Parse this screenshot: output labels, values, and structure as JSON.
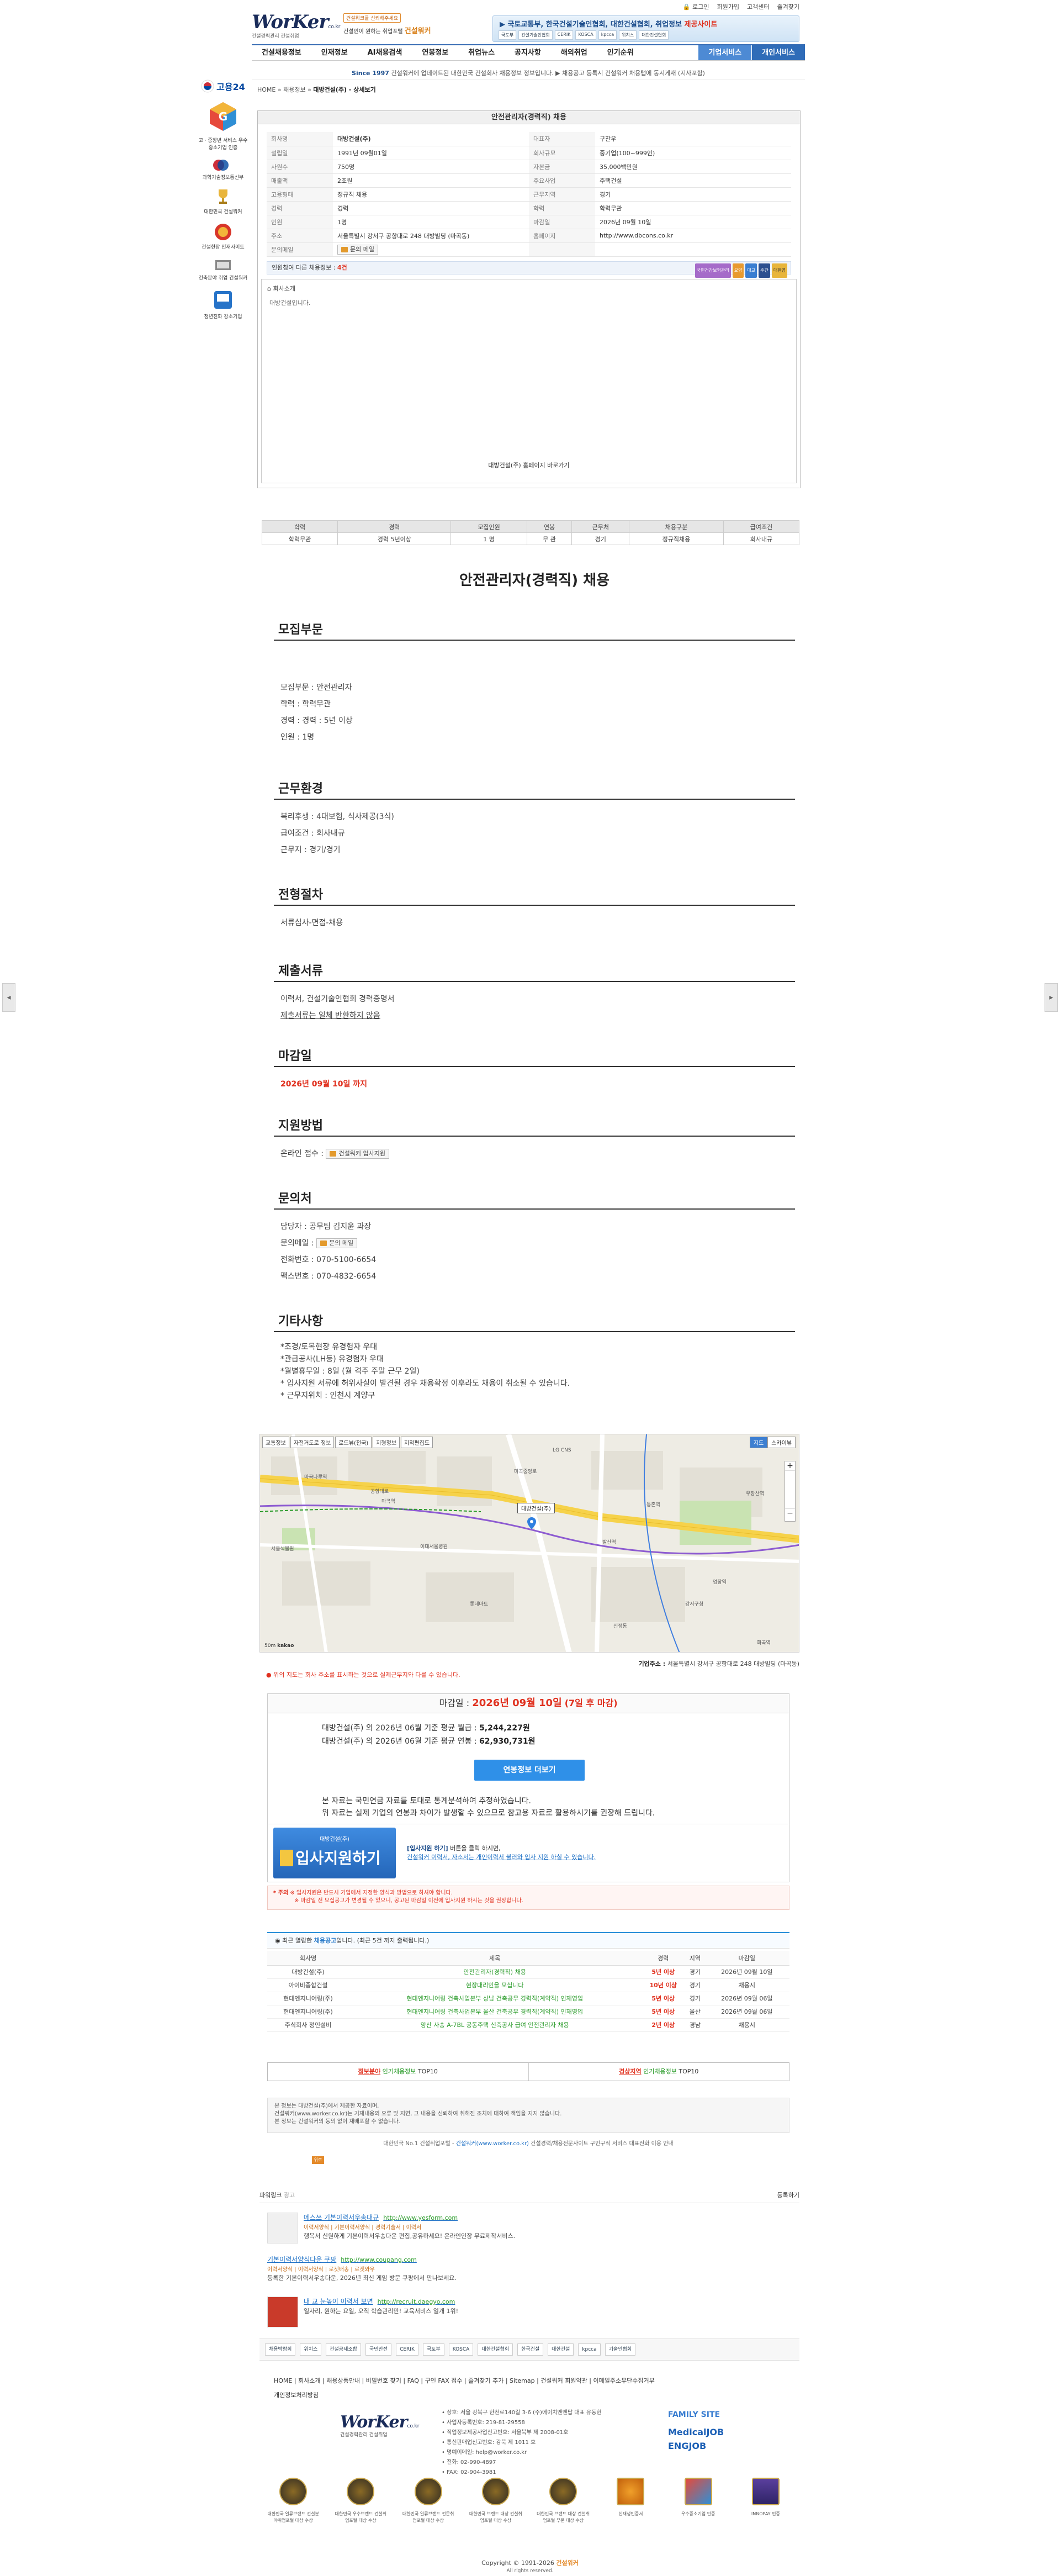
{
  "header": {
    "logo_text": "WorKer",
    "logo_domain": "co.kr",
    "logo_sub": "건설경력관리 건설취업",
    "tagline_badge": "건설워크를 신뢰해주세요",
    "tagline_text": "건설인이 원하는 취업포털",
    "tagline_brand": "건설워커",
    "util": [
      "로그인",
      "회원가입",
      "고객센터",
      "즐겨찾기"
    ],
    "banner_title": "국토교통부, 한국건설기술인협회, 대한건설협회, 취업정보",
    "banner_highlight": "제공사이트",
    "banner_logos": [
      "국토부",
      "건설기술인협회",
      "CERIK",
      "KOSCA",
      "kpcca",
      "위치스",
      "대한건설협회"
    ]
  },
  "nav": {
    "items": [
      "건설채용정보",
      "인재정보",
      "AI채용검색",
      "연봉정보",
      "취업뉴스",
      "공지사항",
      "해외취업",
      "인기순위"
    ],
    "right": [
      "기업서비스",
      "개인서비스"
    ]
  },
  "notice": {
    "since": "Since 1997",
    "text": "건설워커에 업데이트된 대한민국 건설회사 채용정보 정보입니다. ▶ 채용공고 등록시 건설워커 채용탭에 동시게재 (지사포함)"
  },
  "breadcrumb": {
    "home": "HOME",
    "sep1": "»",
    "l1": "채용정보",
    "sep2": "»",
    "l2": "대방건설(주) - 상세보기"
  },
  "sidebar": {
    "items": [
      {
        "label": "고용24",
        "icon": "korea-flag-icon"
      },
      {
        "label": "고 · 중장년 서비스 우수중소기업 인증",
        "icon": "g-cube-icon"
      },
      {
        "label": "과학기술정보통신부",
        "icon": "ministry-icon"
      },
      {
        "label": "대한민국 건설워커",
        "icon": "trophy-icon"
      },
      {
        "label": "건설현장 인재사이트",
        "icon": "red-medal-icon"
      },
      {
        "label": "건축분야 취업 건설워커",
        "icon": "book-icon"
      },
      {
        "label": "청년친화 강소기업",
        "icon": "blue-badge-icon"
      }
    ]
  },
  "job": {
    "box_title": "안전관리자(경력직) 채용",
    "info": [
      [
        "회사명",
        "대방건설(주)",
        "대표자",
        "구찬우"
      ],
      [
        "설립일",
        "1991년 09월01일",
        "회사규모",
        "중기업(100~999인)"
      ],
      [
        "사원수",
        "750명",
        "자본금",
        "35,000백만원"
      ],
      [
        "매출액",
        "2조원",
        "주요사업",
        "주택건설"
      ],
      [
        "고용형태",
        "정규직 채용",
        "근무지역",
        "경기"
      ],
      [
        "경력",
        "경력",
        "학력",
        "학력무관"
      ],
      [
        "인원",
        "1명",
        "마감일",
        "2026년 09월 10일"
      ],
      [
        "주소",
        "서울특별시 강서구 공항대로 248 대방빌딩 (마곡동)",
        "홈페이지",
        "http://www.dbcons.co.kr"
      ],
      [
        "문의메일",
        "문의 메일",
        "",
        ""
      ]
    ],
    "summary_prefix": "인원참여 다른 채용정보 :",
    "summary_count": "4건",
    "summary_tags": [
      "국민건강보험관리",
      "요양",
      "대교",
      "주간",
      "대환영"
    ],
    "intro_header": "회사소개",
    "intro_body": "대방건설입니다.",
    "homepage_link": "대방건설(주) 홈페이지 바로가기"
  },
  "conditions": {
    "headers": [
      "학력",
      "경력",
      "모집인원",
      "연봉",
      "근무처",
      "채용구분",
      "급여조건"
    ],
    "values": [
      "학력무관",
      "경력 5년이상",
      "1 명",
      "무 관",
      "경기",
      "정규직채용",
      "회사내규"
    ]
  },
  "detail": {
    "title": "안전관리자(경력직) 채용",
    "recruit": {
      "heading": "모집부문",
      "lines": [
        "모집부문 : 안전관리자",
        "학력 : 학력무관",
        "경력 : 경력 : 5년 이상",
        "인원 : 1명"
      ]
    },
    "work": {
      "heading": "근무환경",
      "lines": [
        "복리후생 : 4대보험, 식사제공(3식)",
        "급여조건 : 회사내규",
        "근무지 : 경기/경기"
      ]
    },
    "process": {
      "heading": "전형절차",
      "lines": [
        "서류심사-면접-채용"
      ]
    },
    "docs": {
      "heading": "제출서류",
      "lines": [
        "이력서, 건설기술인협회 경력증명서",
        "제출서류는 일체 반환하지 않음"
      ]
    },
    "deadline": {
      "heading": "마감일",
      "value": "2026년 09월 10일 까지"
    },
    "apply": {
      "heading": "지원방법",
      "label": "온라인 접수 :",
      "btn": "건설워커 입사지원"
    },
    "contact": {
      "heading": "문의처",
      "person": "담당자 : 공무팀 김지윤 과장",
      "mail_label": "문의메일 :",
      "mail_btn": "문의 메일",
      "phone": "전화번호 : 070-5100-6654",
      "fax": "팩스번호 : 070-4832-6654"
    },
    "etc": {
      "heading": "기타사항",
      "lines": [
        "*조경/토목현장 유경험자 우대",
        "*관급공사(LH등) 유경험자 우대",
        "*월별휴무일 : 8일 (월 격주 주말 근무 2일)",
        "* 입사지원 서류에 허위사실이 발견될 경우 채용확정 이후라도 채용이 취소될 수 있습니다.",
        "* 근무지위치 : 인천시 계양구"
      ]
    }
  },
  "map": {
    "tabs": [
      "교통정보",
      "자전거도로 정보",
      "로드뷰(전국)",
      "지형정보",
      "지적편집도"
    ],
    "types": [
      "지도",
      "스카이뷰"
    ],
    "pin_label": "대방건설(주)",
    "labels": [
      "마곡나루역",
      "LG CNS",
      "발산역",
      "우장산역",
      "마곡역",
      "서울식물원",
      "이대서울병원",
      "롯데마트",
      "강서구청",
      "신정동",
      "화곡역",
      "공항대로",
      "마곡중앙로",
      "등촌역",
      "염창역"
    ],
    "scale": "50m",
    "copyright": "kakao",
    "address_label": "기업주소 :",
    "address": "서울특별시 강서구 공항대로 248 대방빌딩 (마곡동)",
    "note": "위의 지도는 회사 주소를 표시하는 것으로 실제근무지와 다를 수 있습니다."
  },
  "stats": {
    "deadline_prefix": "마감일 :",
    "deadline_date": "2026년 09월 10일",
    "deadline_suffix": "(7일 후 마감)",
    "line1_pre": "대방건설(주) 의 2026년 06월 기준 평균 월급 :",
    "line1_val": "5,244,227원",
    "line2_pre": "대방건설(주) 의 2026년 06월 기준 평균 연봉 :",
    "line2_val": "62,930,731원",
    "btn": "연봉정보 더보기",
    "note1": "본 자료는 국민연금 자료를 토대로 통계분석하여 추정하였습니다.",
    "note2": "위 자료는 실제 기업의 연봉과 차이가 발생할 수 있으므로 참고용 자료로 활용하시기를 권장해 드립니다."
  },
  "apply_box": {
    "small": "대방건설(주)",
    "big": "입사지원하기",
    "desc_title": "[입사지원 하기]",
    "desc_text": "버튼을 클릭 하시면,",
    "desc_sub": "건설워커 이력서, 자소서는 개인이력서 불러와 입사 지원 하실 수 있습니다."
  },
  "warning": {
    "title": "* 주의",
    "l1": "※ 입사지원은 반드시 기업에서 지정한 양식과 방법으로 하셔야 합니다.",
    "l2": "※ 마감일 전 모집공고가 변경될 수 있으니, 공고된 마감일 이전에 입사지원 하시는 것을 권장합니다."
  },
  "recent": {
    "title_pre": "최근 열람한",
    "title_b": "채용공고",
    "title_post": "입니다.",
    "note": "(최근 5건 까지 출력됩니다.)",
    "headers": [
      "회사명",
      "제목",
      "경력",
      "지역",
      "마감일"
    ],
    "rows": [
      [
        "대방건설(주)",
        "안전관리자(경력직) 채용",
        "5년 이상",
        "경기",
        "2026년 09월 10일"
      ],
      [
        "아이비종합건설",
        "현장대리인을 모십니다",
        "10년 이상",
        "경기",
        "채용시"
      ],
      [
        "현대엔지니어링(주)",
        "현대엔지니어링 건축사업본부 상남 건축공무 경력직(계약직) 인재영입",
        "5년 이상",
        "경기",
        "2026년 09월 06일"
      ],
      [
        "현대엔지니어링(주)",
        "현대엔지니어링 건축사업본부 울산 건축공무 경력직(계약직) 인재영입",
        "5년 이상",
        "울산",
        "2026년 09월 06일"
      ],
      [
        "주식회사 정인설비",
        "양산 사송 A-7BL 공동주택 신축공사 급여 안전관리자 채용",
        "2년 이상",
        "경남",
        "채용시"
      ]
    ]
  },
  "top10": {
    "left_red": "정보분야",
    "left_green": "인기채용정보",
    "left_suffix": "TOP10",
    "right_red": "경상지역",
    "right_green": "인기채용정보",
    "right_suffix": "TOP10"
  },
  "legal": {
    "l1": "본 정보는 대방건설(주)에서 제공한 자료이며,",
    "l2": "건설워커(www.worker.co.kr)는 기재내용의 오류 및 지연, 그 내용을 신뢰하여 취해진 조치에 대하여 책임을 지지 않습니다.",
    "l3": "본 정보는 건설워커의 동의 없이 재배포할 수 없습니다."
  },
  "legal_foot": {
    "pre": "대한민국 No.1 건설취업포털",
    "link": "건설워커(www.worker.co.kr)",
    "post": "건설경력/채용전문사이트 구인구직 서비스 대표전화 이용 안내"
  },
  "top_btn": "위로",
  "recsites": {
    "title": "파워링크",
    "sub": "광고",
    "register": "등록하기",
    "items": [
      {
        "title": "에스쓰 기본이력서우송대규",
        "url": "http://www.yesform.com",
        "tags": "이력서양식 | 기본이력서양식 | 경력기술서 | 이력서",
        "desc": "행복서 신원하게 기본이력서우송다운 편집,공유하세요! 온라인인장 무료제작서비스."
      },
      {
        "title": "기본이력서양식다운 쿠팡",
        "url": "http://www.coupang.com",
        "tags": "이력서양식 | 이력서양식 | 로켓배송 | 로켓와우",
        "desc": "등록한 기본이력서우송다운, 2026년 최신 게임 방문 쿠팡에서 만나보세요."
      },
      {
        "title": "내 교 눈높이 이력서 보면",
        "url": "http://recruit.daegyo.com",
        "tags": "",
        "desc": "일자리, 원하는 요일, 오직 학습관리만! 교육서비스 일개 1위!"
      }
    ]
  },
  "partners": [
    "채용박람회",
    "위치스",
    "건설공제조합",
    "국민안전",
    "CERIK",
    "국토부",
    "KOSCA",
    "대한건설협회",
    "한국건설",
    "대한건설",
    "kpcca",
    "기술인협회"
  ],
  "footer": {
    "nav": "HOME | 회사소개 | 채용상품안내 | 비밀번호 찾기 | FAQ | 구인 FAX 접수 | 즐겨찾기 추가 | Sitemap | 건설워커 회원약관 | 이메일주소무단수집거부",
    "privacy": "개인정보처리방침",
    "info": [
      "• 상호: 서울 강북구 한천로140길 3-6 (주)에이치앤엔탑 대표 유동현",
      "• 사업자등록번호: 219-81-29558",
      "• 직업정보제공사업신고번호: 서울북부 제 2008-01호",
      "• 통신판매업신고번호: 강북 제 1011 호",
      "• 명예이메일: help@worker.co.kr",
      "• 전화: 02-990-4897",
      "• FAX: 02-904-3981"
    ],
    "family_title": "FAMILY SITE",
    "family_m": "MedicalJOB",
    "family_e": "ENGJOB",
    "badges": [
      "대한민국 일류브랜드 건설분야취업포털 대상 수상",
      "대한민국 우수브랜드 건설취업포털 대상 수상",
      "대한민국 일류브랜드 전문취업포털 대상 수상",
      "대한민국 브랜드 대상 건설취업포털 대상 수상",
      "대한민국 브랜드 대상 건설취업포털 부문 대상 수상",
      "신재생인증서",
      "우수중소기업 인증",
      "INNOPAY 인증"
    ],
    "copyright_pre": "Copyright © 1991-2026",
    "copyright_brand": "건설워커",
    "rights": "All rights reserved."
  },
  "colors": {
    "accent": "#3b6fb5",
    "danger": "#e0301e",
    "green": "#2a9b2a",
    "orange": "#e48a2a"
  }
}
